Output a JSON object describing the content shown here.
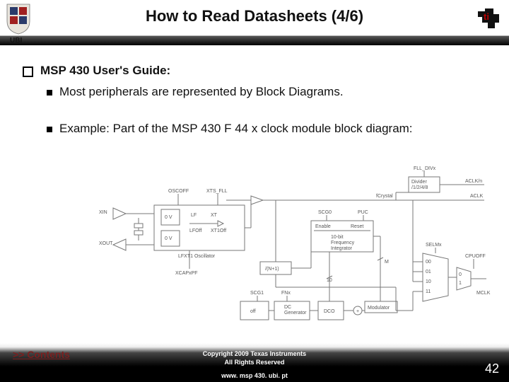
{
  "header": {
    "title": "How to Read Datasheets (4/6)",
    "org_label": "UBI"
  },
  "body": {
    "l1_text": "MSP 430 User's Guide:",
    "l2a_text": "Most peripherals are represented by Block Diagrams.",
    "l2b_text": "Example: Part of the MSP 430 F 44 x clock module block diagram:"
  },
  "diagram": {
    "fll_divx": "FLL_DIVx",
    "divider": "Divider\n/1/2/4/8",
    "aclk_n": "ACLK/n",
    "fcrystal": "fCrystal",
    "aclk": "ACLK",
    "oscoff": "OSCOFF",
    "xts_fll": "XTS_FLL",
    "xin": "XIN",
    "xout": "XOUT",
    "zero_v": "0 V",
    "lf": "LF",
    "xt": "XT",
    "lfoff": "LFOff",
    "xt1off": "XT1Off",
    "lfxt1": "LFXT1 Oscillator",
    "xcap": "XCAPxPF",
    "scg0": "SCG0",
    "puc": "PUC",
    "enable": "Enable",
    "reset": "Reset",
    "integrator": "10-bit\nFrequency\nIntegrator",
    "fn1": "/(N+1)",
    "ten": "10",
    "m": "M",
    "scg1": "SCG1",
    "fnx": "FNx",
    "off": "off",
    "dcgen": "DC\nGenerator",
    "dco": "DCO",
    "plus": "+",
    "modulator": "Modulator",
    "selmx": "SELMx",
    "cpuoff": "CPUOFF",
    "mux00": "00",
    "mux01": "01",
    "mux10": "10",
    "mux11": "11",
    "mux0": "0",
    "mux1": "1",
    "mclk": "MCLK"
  },
  "footer": {
    "contents_link": ">> Contents",
    "copyright_line1": "Copyright  2009 Texas Instruments",
    "copyright_line2": "All Rights Reserved",
    "url": "www. msp 430. ubi. pt",
    "page_number": "42"
  }
}
